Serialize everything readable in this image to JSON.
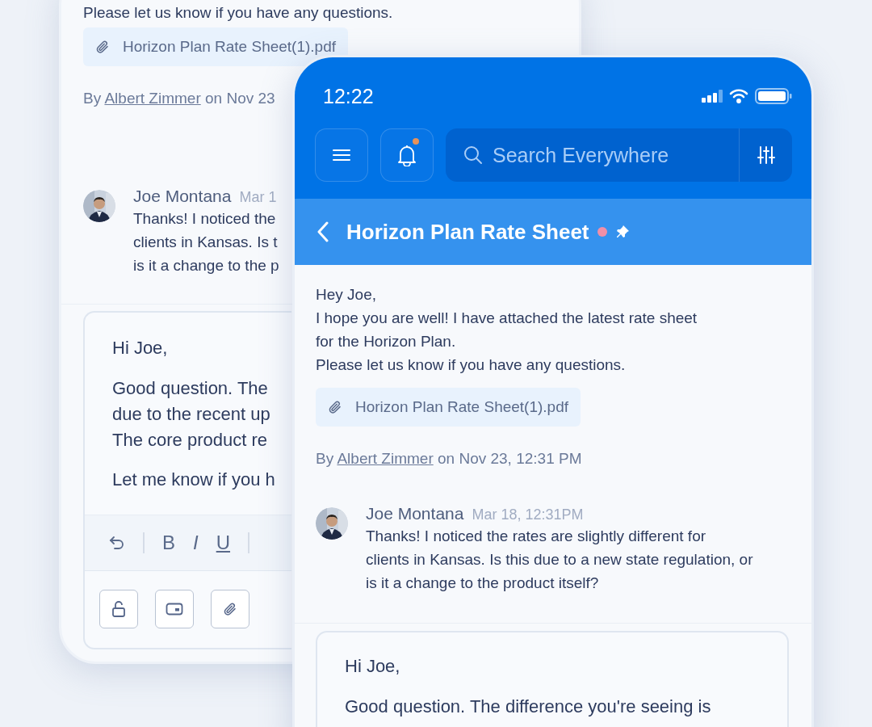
{
  "back_screen": {
    "message_tail": "Please let us know if you have any questions.",
    "attachment": {
      "file_name": "Horizon Plan Rate Sheet(1).pdf"
    },
    "byline": {
      "prefix": "By",
      "author": "Albert Zimmer",
      "suffix": "on Nov 23"
    },
    "comment": {
      "author": "Joe Montana",
      "time": "Mar 1",
      "lines": [
        "Thanks! I noticed the",
        "clients in Kansas. Is t",
        "is it a change to the p"
      ]
    },
    "reply": {
      "greeting": "Hi Joe,",
      "paragraphs": [
        [
          "Good question. The",
          "due to the recent up",
          "The core product re"
        ],
        [
          "Let me know if you h"
        ]
      ]
    },
    "toolbar": [
      {
        "kind": "undo"
      },
      {
        "kind": "separator"
      },
      {
        "kind": "bold",
        "label": "B"
      },
      {
        "kind": "italic",
        "label": "I"
      },
      {
        "kind": "underline",
        "label": "U"
      },
      {
        "kind": "separator"
      }
    ],
    "actions": [
      {
        "kind": "lock"
      },
      {
        "kind": "card"
      },
      {
        "kind": "attach"
      }
    ]
  },
  "front_screen": {
    "status_bar": {
      "time": "12:22"
    },
    "top_bar": {
      "notifications_unread": true,
      "search": {
        "placeholder": "Search Everywhere"
      }
    },
    "header": {
      "title": "Horizon Plan Rate Sheet",
      "unread": true,
      "pinned": true
    },
    "message": {
      "lines": [
        "Hey Joe,",
        "I hope you are well! I have attached the latest rate sheet",
        "for the Horizon Plan.",
        "Please let us know if you have any questions."
      ],
      "attachment": {
        "file_name": "Horizon Plan Rate Sheet(1).pdf"
      },
      "byline": {
        "prefix": "By",
        "author": "Albert Zimmer",
        "suffix": "on Nov 23, 12:31 PM"
      }
    },
    "comment": {
      "author": "Joe Montana",
      "time": "Mar 18, 12:31PM",
      "lines": [
        "Thanks! I noticed the rates are slightly different for",
        "clients in Kansas. Is this due to a new state regulation, or",
        "is it a change to the product itself?"
      ]
    },
    "reply": {
      "greeting": "Hi Joe,",
      "paragraphs": [
        [
          "Good question. The difference you're seeing is"
        ]
      ]
    }
  }
}
